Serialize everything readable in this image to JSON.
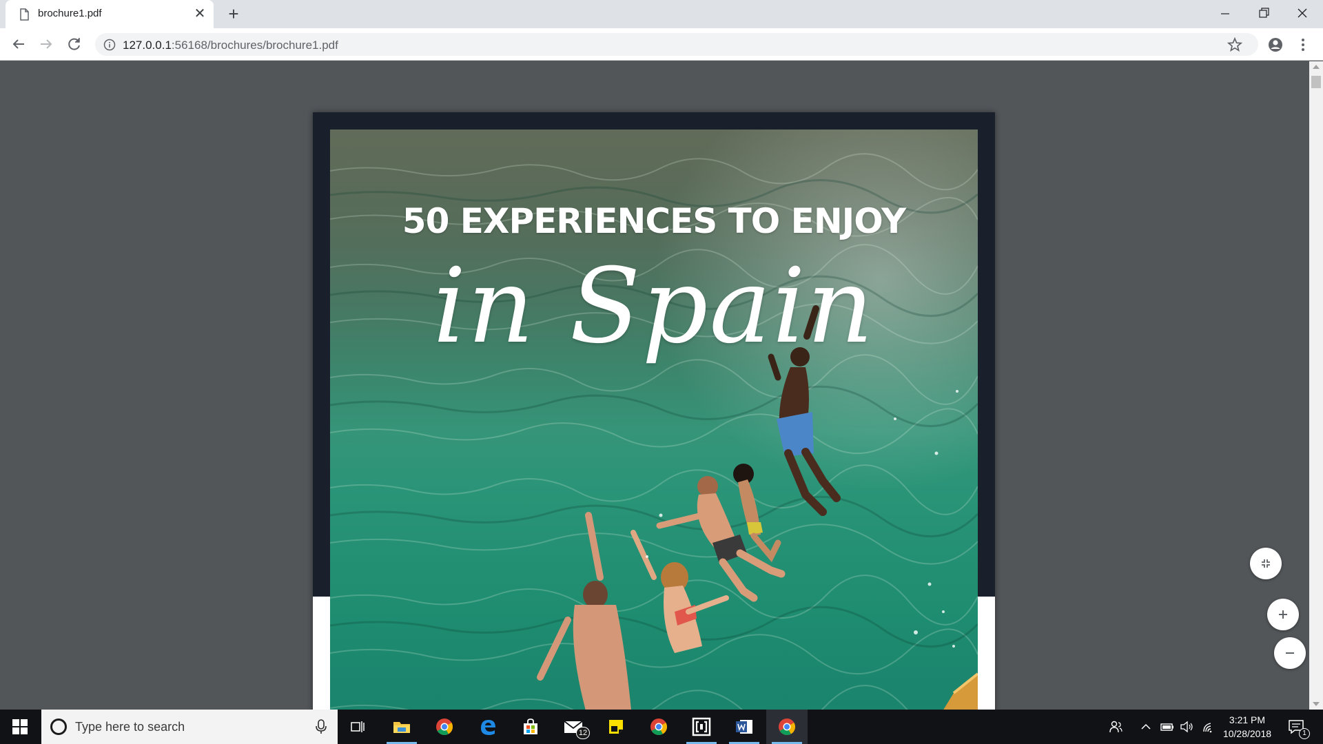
{
  "browser": {
    "tab": {
      "title": "brochure1.pdf",
      "close_glyph": "✕",
      "icon": "document-icon"
    },
    "new_tab_glyph": "+",
    "url": {
      "host": "127.0.0.1",
      "port_path": ":56168/brochures/brochure1.pdf"
    }
  },
  "pdf": {
    "headline": "50 EXPERIENCES TO ENJOY",
    "script_title": "in Spain",
    "page_border_color": "#1a1f2c",
    "zoom_buttons": [
      "fit-to-page",
      "zoom-in",
      "zoom-out"
    ]
  },
  "taskbar": {
    "search_placeholder": "Type here to search",
    "mail_badge": "12",
    "clock_time": "3:21 PM",
    "clock_date": "10/28/2018",
    "notification_count": "1",
    "pinned_apps": [
      "task-view",
      "file-explorer",
      "chrome",
      "edge",
      "store",
      "mail",
      "sticky-notes",
      "chrome",
      "app",
      "word",
      "chrome"
    ]
  }
}
